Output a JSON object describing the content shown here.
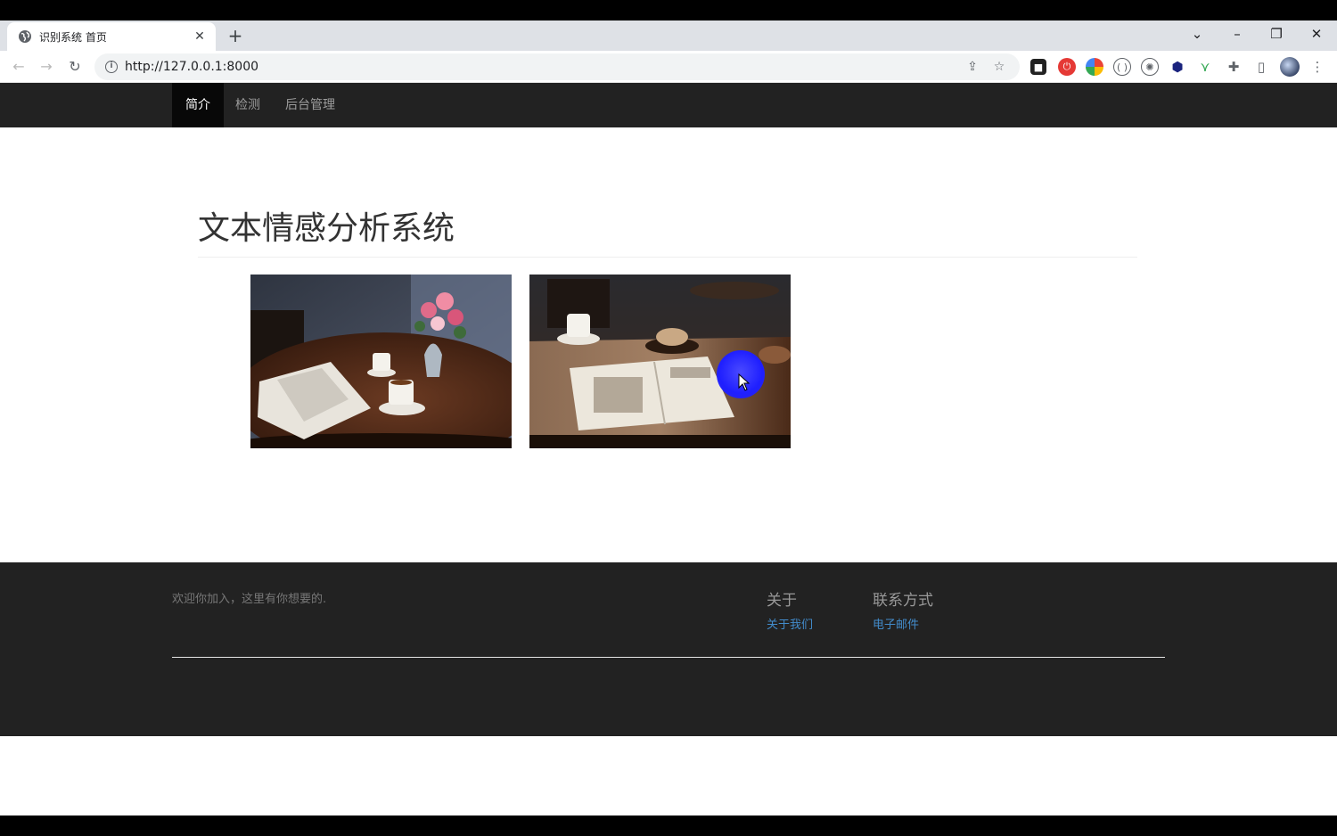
{
  "browser": {
    "tab_title": "识别系统 首页",
    "url": "http://127.0.0.1:8000"
  },
  "nav": {
    "items": [
      {
        "label": "简介",
        "active": true
      },
      {
        "label": "检测",
        "active": false
      },
      {
        "label": "后台管理",
        "active": false
      }
    ]
  },
  "main": {
    "title": "文本情感分析系统",
    "images": [
      {
        "subject": "coffee cups, roses and newspaper on round table"
      },
      {
        "subject": "open newspaper with coffee cups on wooden cafe table"
      }
    ]
  },
  "footer": {
    "welcome": "欢迎你加入，这里有你想要的.",
    "about_title": "关于",
    "about_link": "关于我们",
    "contact_title": "联系方式",
    "contact_link": "电子邮件"
  },
  "colors": {
    "navbar_bg": "#222222",
    "navbar_active": "#080808",
    "link_blue": "#428bca",
    "footer_bg": "#222222"
  }
}
